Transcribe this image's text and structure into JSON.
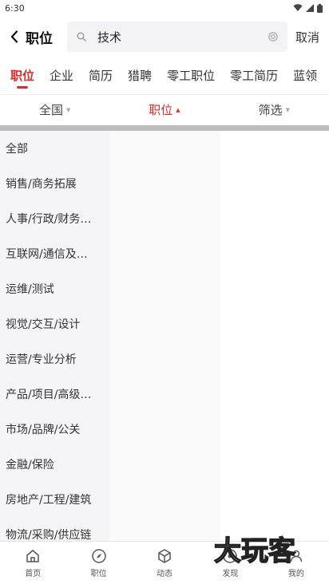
{
  "status_bar": {
    "time": "6:30"
  },
  "header": {
    "title": "职位",
    "search_value": "技术",
    "cancel_label": "取消"
  },
  "tabs": [
    {
      "label": "职位",
      "active": true
    },
    {
      "label": "企业"
    },
    {
      "label": "简历"
    },
    {
      "label": "猎聘"
    },
    {
      "label": "零工职位"
    },
    {
      "label": "零工简历"
    },
    {
      "label": "蓝领"
    }
  ],
  "filters": [
    {
      "label": "全国",
      "arrow": "down"
    },
    {
      "label": "职位",
      "arrow": "up",
      "active": true
    },
    {
      "label": "筛选",
      "arrow": "down"
    }
  ],
  "categories": [
    "全部",
    "销售/商务拓展",
    "人事/行政/财务…",
    "互联网/通信及…",
    "运维/测试",
    "视觉/交互/设计",
    "运营/专业分析",
    "产品/项目/高级…",
    "市场/品牌/公关",
    "金融/保险",
    "房地产/工程/建筑",
    "物流/采购/供应链"
  ],
  "bottom_nav": [
    {
      "label": "首页",
      "icon": "home-icon"
    },
    {
      "label": "职位",
      "icon": "compass-icon"
    },
    {
      "label": "动态",
      "icon": "cube-icon"
    },
    {
      "label": "发现",
      "icon": "discover-icon"
    },
    {
      "label": "我的",
      "icon": "profile-icon"
    }
  ],
  "watermark": {
    "text": "大玩客"
  },
  "colors": {
    "accent": "#e02a2a",
    "list_bg": "#f5f5f7",
    "divider": "#bdbdbd"
  }
}
